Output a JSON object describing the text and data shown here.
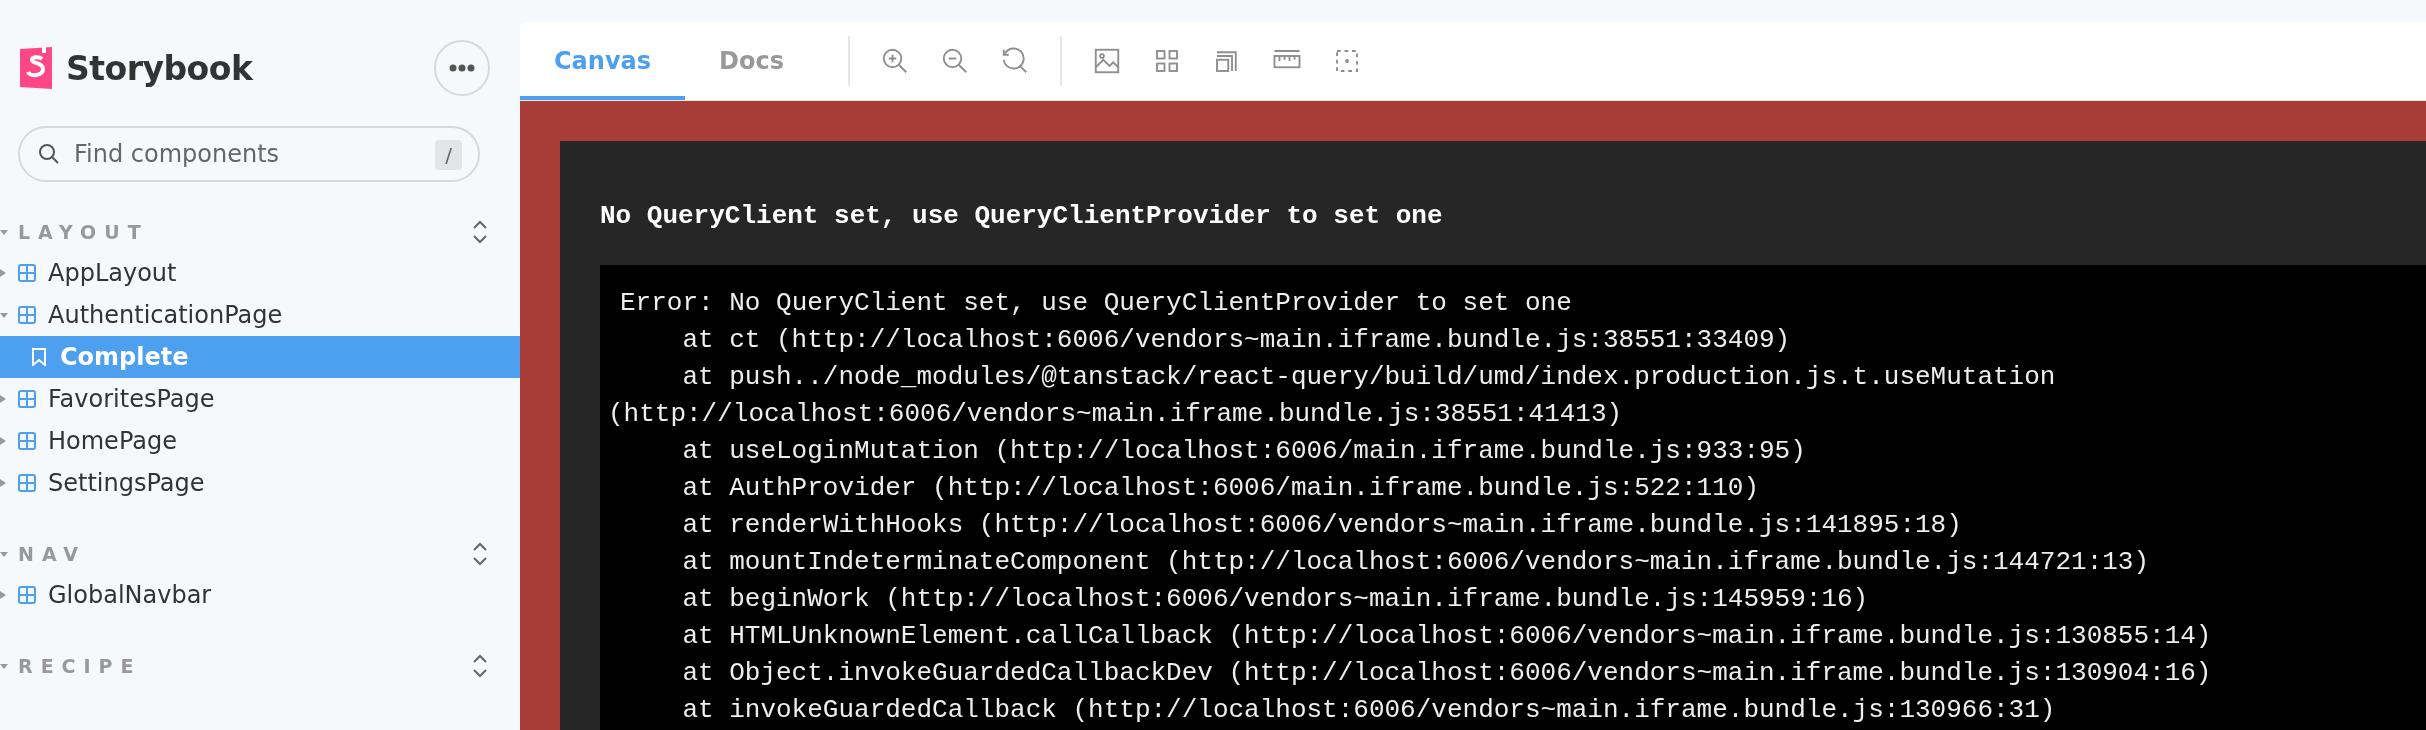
{
  "sidebar": {
    "brand": "Storybook",
    "search": {
      "placeholder": "Find components",
      "shortcut": "/"
    },
    "groups": [
      {
        "title": "LAYOUT",
        "items": [
          {
            "label": "AppLayout",
            "kind": "component",
            "expanded": false,
            "selected": false
          },
          {
            "label": "AuthenticationPage",
            "kind": "component",
            "expanded": true,
            "selected": false,
            "children": [
              {
                "label": "Complete",
                "kind": "story",
                "selected": true
              }
            ]
          },
          {
            "label": "FavoritesPage",
            "kind": "component",
            "expanded": false,
            "selected": false
          },
          {
            "label": "HomePage",
            "kind": "component",
            "expanded": false,
            "selected": false
          },
          {
            "label": "SettingsPage",
            "kind": "component",
            "expanded": false,
            "selected": false
          }
        ]
      },
      {
        "title": "NAV",
        "items": [
          {
            "label": "GlobalNavbar",
            "kind": "component",
            "expanded": false,
            "selected": false
          }
        ]
      },
      {
        "title": "RECIPE"
      }
    ]
  },
  "toolbar": {
    "tabs": [
      {
        "label": "Canvas",
        "selected": true
      },
      {
        "label": "Docs",
        "selected": false
      }
    ],
    "tools": [
      {
        "kind": "zoom-in"
      },
      {
        "kind": "zoom-out"
      },
      {
        "kind": "zoom-reset"
      },
      {
        "kind": "divider"
      },
      {
        "kind": "background"
      },
      {
        "kind": "grid"
      },
      {
        "kind": "viewport"
      },
      {
        "kind": "measure"
      },
      {
        "kind": "outline"
      }
    ]
  },
  "error": {
    "title": "No QueryClient set, use QueryClientProvider to set one",
    "stack": [
      {
        "kind": "message",
        "text": "Error: No QueryClient set, use QueryClientProvider to set one"
      },
      {
        "kind": "frame",
        "text": "at ct (http://localhost:6006/vendors~main.iframe.bundle.js:38551:33409)"
      },
      {
        "kind": "frame",
        "text": "at push../node_modules/@tanstack/react-query/build/umd/index.production.js.t.useMutation"
      },
      {
        "kind": "continuation",
        "text": "(http://localhost:6006/vendors~main.iframe.bundle.js:38551:41413)"
      },
      {
        "kind": "frame",
        "text": "at useLoginMutation (http://localhost:6006/main.iframe.bundle.js:933:95)"
      },
      {
        "kind": "frame",
        "text": "at AuthProvider (http://localhost:6006/main.iframe.bundle.js:522:110)"
      },
      {
        "kind": "frame",
        "text": "at renderWithHooks (http://localhost:6006/vendors~main.iframe.bundle.js:141895:18)"
      },
      {
        "kind": "frame",
        "text": "at mountIndeterminateComponent (http://localhost:6006/vendors~main.iframe.bundle.js:144721:13)"
      },
      {
        "kind": "frame",
        "text": "at beginWork (http://localhost:6006/vendors~main.iframe.bundle.js:145959:16)"
      },
      {
        "kind": "frame",
        "text": "at HTMLUnknownElement.callCallback (http://localhost:6006/vendors~main.iframe.bundle.js:130855:14)"
      },
      {
        "kind": "frame",
        "text": "at Object.invokeGuardedCallbackDev (http://localhost:6006/vendors~main.iframe.bundle.js:130904:16)"
      },
      {
        "kind": "frame",
        "text": "at invokeGuardedCallback (http://localhost:6006/vendors~main.iframe.bundle.js:130966:31)"
      }
    ]
  }
}
